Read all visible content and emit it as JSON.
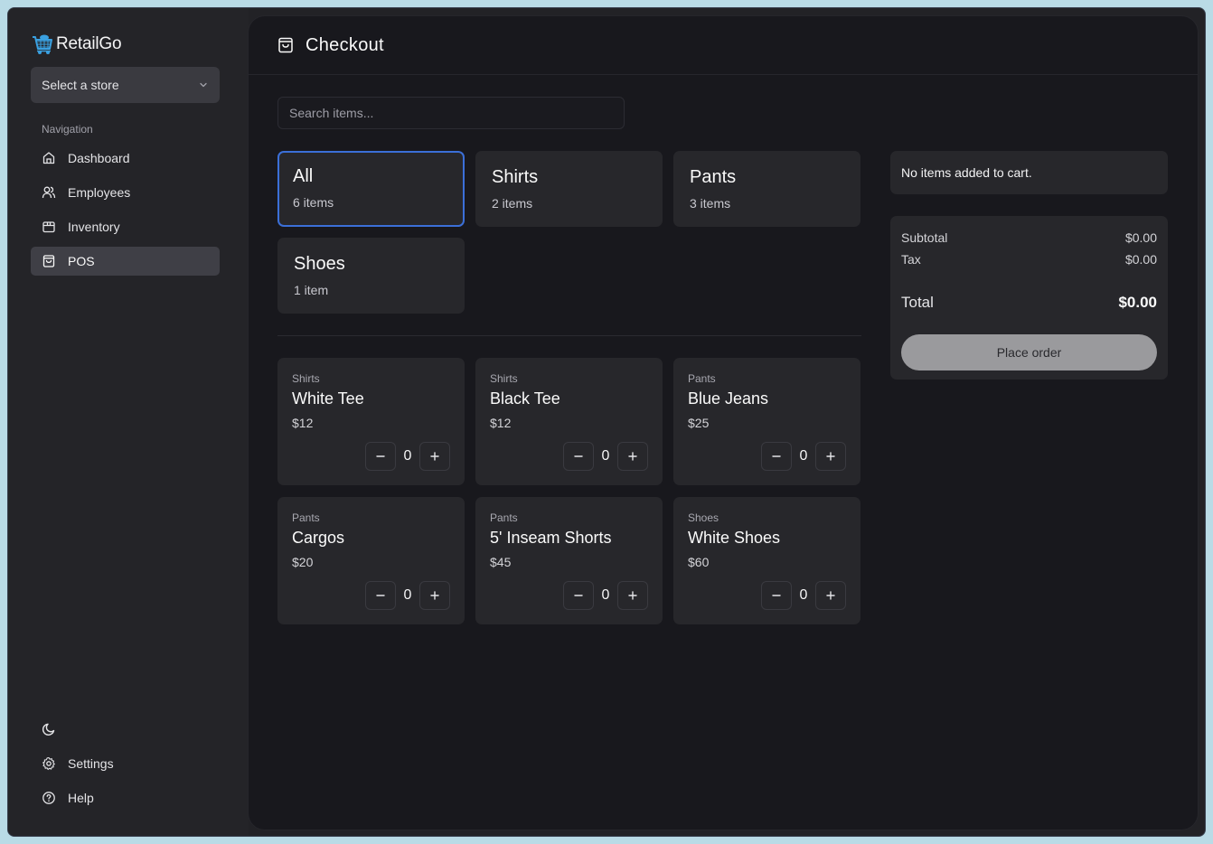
{
  "app": {
    "brand_name": "RetailGo",
    "store_select": {
      "value": "Select a store"
    }
  },
  "sidebar": {
    "section_label": "Navigation",
    "items": [
      {
        "label": "Dashboard",
        "icon": "home-icon",
        "active": false
      },
      {
        "label": "Employees",
        "icon": "users-icon",
        "active": false
      },
      {
        "label": "Inventory",
        "icon": "package-icon",
        "active": false
      },
      {
        "label": "POS",
        "icon": "shopping-bag-icon",
        "active": true
      }
    ],
    "bottom": {
      "theme_toggle_icon": "moon-icon",
      "settings_label": "Settings",
      "help_label": "Help"
    }
  },
  "page": {
    "title": "Checkout",
    "title_icon": "shopping-bag-icon",
    "search": {
      "placeholder": "Search items...",
      "value": ""
    }
  },
  "categories": [
    {
      "name": "All",
      "count": "6 items",
      "selected": true
    },
    {
      "name": "Shirts",
      "count": "2 items",
      "selected": false
    },
    {
      "name": "Pants",
      "count": "3 items",
      "selected": false
    },
    {
      "name": "Shoes",
      "count": "1 item",
      "selected": false
    }
  ],
  "items": [
    {
      "category": "Shirts",
      "name": "White Tee",
      "price": "$12",
      "qty": "0"
    },
    {
      "category": "Shirts",
      "name": "Black Tee",
      "price": "$12",
      "qty": "0"
    },
    {
      "category": "Pants",
      "name": "Blue Jeans",
      "price": "$25",
      "qty": "0"
    },
    {
      "category": "Pants",
      "name": "Cargos",
      "price": "$20",
      "qty": "0"
    },
    {
      "category": "Pants",
      "name": "5' Inseam Shorts",
      "price": "$45",
      "qty": "0"
    },
    {
      "category": "Shoes",
      "name": "White Shoes",
      "price": "$60",
      "qty": "0"
    }
  ],
  "cart": {
    "empty_message": "No items added to cart.",
    "subtotal_label": "Subtotal",
    "subtotal": "$0.00",
    "tax_label": "Tax",
    "tax": "$0.00",
    "total_label": "Total",
    "total": "$0.00",
    "place_order_label": "Place order"
  },
  "colors": {
    "accent_selected": "#3b6fd8",
    "brand_icon": "#3aa0e0",
    "background_outer": "#b9dbe6"
  }
}
